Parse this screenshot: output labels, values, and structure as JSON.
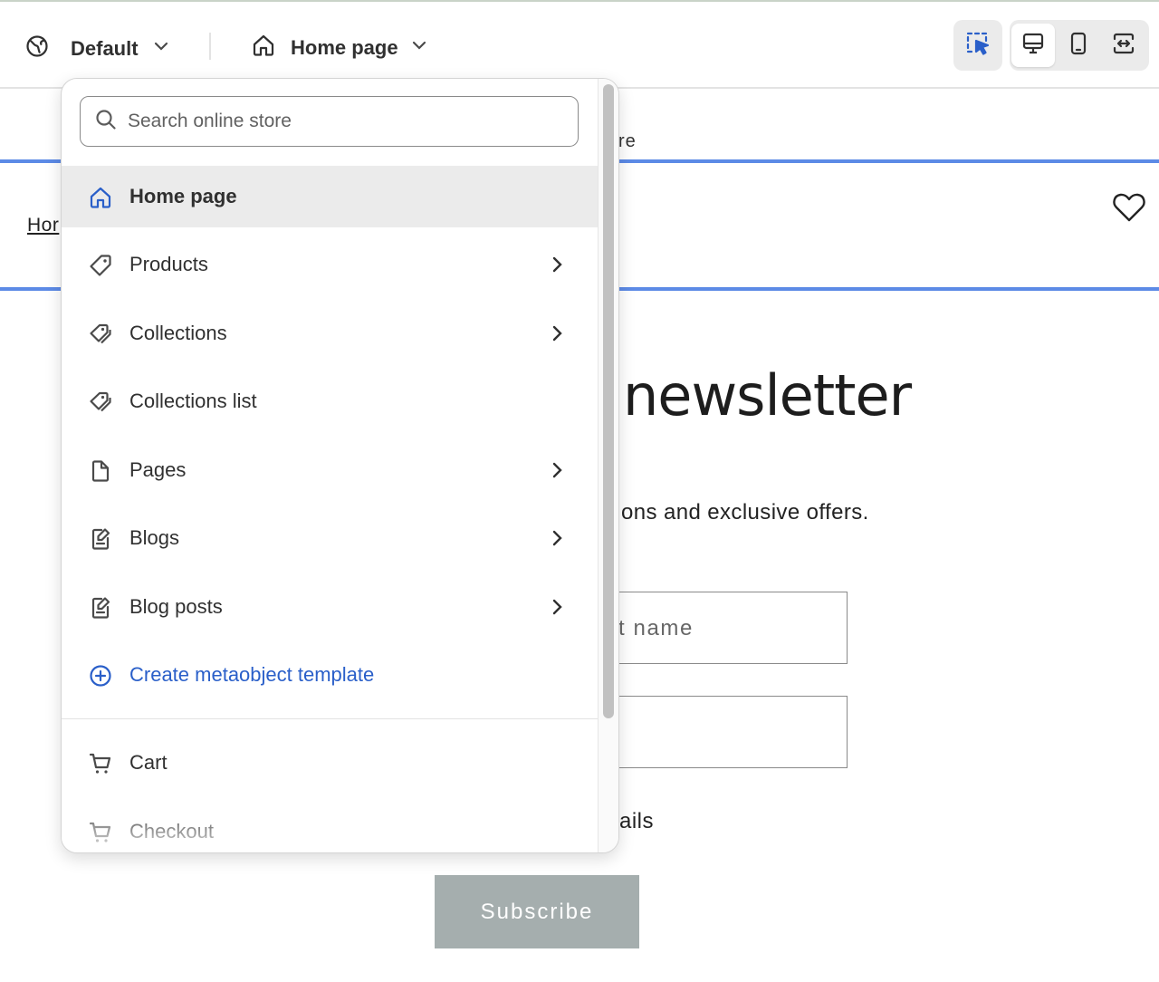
{
  "topbar": {
    "theme_label": "Default",
    "page_label": "Home page",
    "icons": [
      "globe-icon",
      "chevron-down-icon",
      "home-icon",
      "inspector-icon",
      "desktop-icon",
      "mobile-icon",
      "fullscreen-icon"
    ],
    "active_view": "desktop"
  },
  "dropdown": {
    "search_placeholder": "Search online store",
    "items": [
      {
        "label": "Home page",
        "icon": "home-icon",
        "selected": true,
        "has_submenu": false
      },
      {
        "label": "Products",
        "icon": "tag-icon",
        "has_submenu": true
      },
      {
        "label": "Collections",
        "icon": "tags-icon",
        "has_submenu": true
      },
      {
        "label": "Collections list",
        "icon": "tags-icon",
        "has_submenu": false
      },
      {
        "label": "Pages",
        "icon": "page-icon",
        "has_submenu": true
      },
      {
        "label": "Blogs",
        "icon": "blog-icon",
        "has_submenu": true
      },
      {
        "label": "Blog posts",
        "icon": "blog-icon",
        "has_submenu": true
      },
      {
        "label": "Create metaobject template",
        "icon": "plus-circle-icon",
        "link": true
      }
    ],
    "secondary_items": [
      {
        "label": "Cart",
        "icon": "cart-icon"
      },
      {
        "label": "Checkout",
        "icon": "cart-icon"
      }
    ]
  },
  "preview": {
    "announcement_fragment": "re",
    "breadcrumb_fragment": "Hor",
    "newsletter_title_fragment": "newsletter",
    "newsletter_sub_fragment": "ons and exclusive offers.",
    "name_field_fragment": "t name",
    "note_fragment": "ails",
    "subscribe_label": "Subscribe"
  },
  "colors": {
    "accent_blue": "#2a5fc9",
    "preview_divider": "#5c8ae6",
    "subscribe_bg": "#a5aeae",
    "selected_bg": "#ebebeb"
  }
}
